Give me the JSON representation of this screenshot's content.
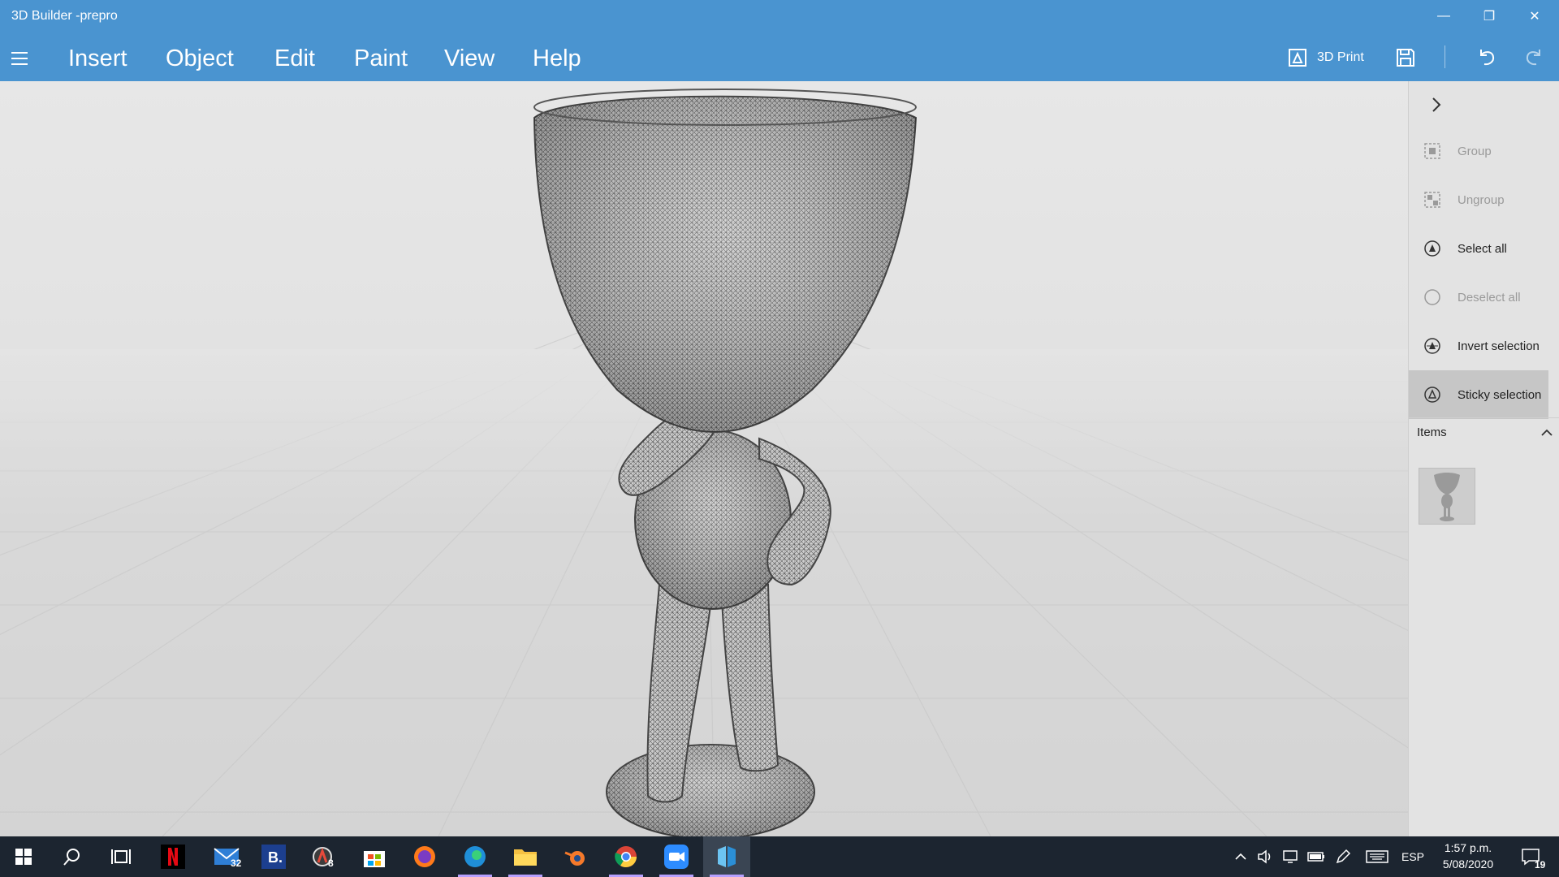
{
  "window": {
    "title": "3D Builder -prepro",
    "minimize": "—",
    "maximize": "❐",
    "close": "✕"
  },
  "menu": {
    "items": [
      "Insert",
      "Object",
      "Edit",
      "Paint",
      "View",
      "Help"
    ]
  },
  "toolbar": {
    "print_label": "3D Print",
    "icons": [
      "print-icon",
      "save-icon",
      "undo-icon",
      "redo-icon"
    ]
  },
  "panel": {
    "actions": [
      {
        "label": "Group",
        "enabled": false
      },
      {
        "label": "Ungroup",
        "enabled": false
      },
      {
        "label": "Select all",
        "enabled": true
      },
      {
        "label": "Deselect all",
        "enabled": false
      },
      {
        "label": "Invert selection",
        "enabled": true
      },
      {
        "label": "Sticky selection",
        "enabled": true,
        "active": true
      }
    ],
    "items_header": "Items"
  },
  "taskbar": {
    "mail_badge": "32",
    "app8_badge": "8",
    "language": "ESP",
    "time": "1:57 p.m.",
    "date": "5/08/2020",
    "notifications": "19"
  },
  "colors": {
    "accent": "#4a94d0",
    "taskbar": "#1c2530",
    "panel": "#e3e3e3"
  }
}
